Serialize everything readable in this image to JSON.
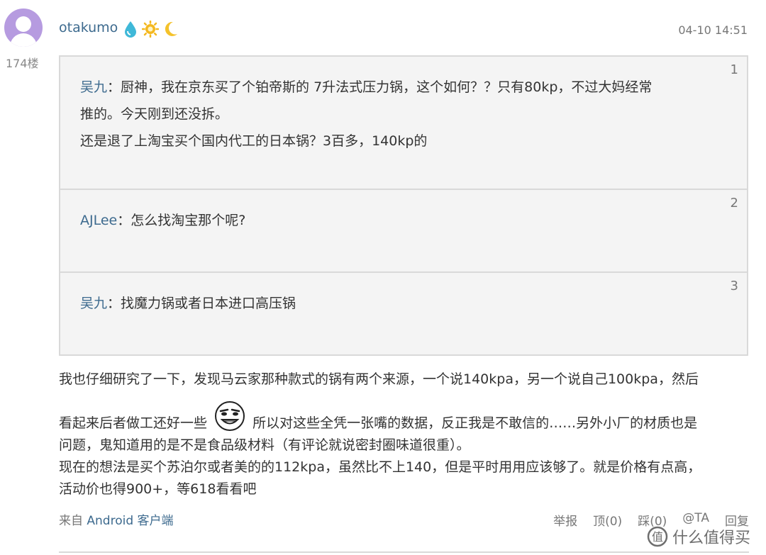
{
  "post": {
    "floor": "174楼",
    "username": "otakumo",
    "time": "04-10 14:51"
  },
  "quotes": [
    {
      "num": "1",
      "author": "吴九",
      "sep": "：",
      "lines": [
        "厨神，我在京东买了个铂帝斯的 7升法式压力锅，这个如何？？只有80kp，不过大妈经常",
        "推的。今天刚到还没拆。",
        "还是退了上淘宝买个国内代工的日本锅？3百多，140kp的"
      ]
    },
    {
      "num": "2",
      "author": "AJLee",
      "sep": "：",
      "lines": [
        "怎么找淘宝那个呢?"
      ]
    },
    {
      "num": "3",
      "author": "吴九",
      "sep": "：",
      "lines": [
        "找魔力锅或者日本进口高压锅"
      ]
    }
  ],
  "body": {
    "line1": "我也仔细研究了一下，发现马云家那种款式的锅有两个来源，一个说140kpa，另一个说自己100kpa，然后",
    "line2a": "看起来后者做工还好一些",
    "line2b": "所以对这些全凭一张嘴的数据，反正我是不敢信的……另外小厂的材质也是",
    "line3": "问题，鬼知道用的是不是食品级材料（有评论就说密封圈味道很重）。",
    "line4": "现在的想法是买个苏泊尔或者美的的112kpa，虽然比不上140，但是平时用用应该够了。就是价格有点高，",
    "line5": "活动价也得900+，等618看看吧"
  },
  "footer": {
    "from_label": "来自",
    "client": "Android 客户端",
    "report": "举报",
    "up": "顶(0)",
    "down": "踩(0)",
    "at": "@TA",
    "reply": "回复"
  },
  "watermark": {
    "text": "什么值得买",
    "badge": "值"
  },
  "colors": {
    "link": "#3d6a8e",
    "avatar": "#b69be0",
    "quote_bg": "#f4f4f4",
    "quote_border": "#d9d9d9"
  },
  "icons": [
    "user-avatar-icon",
    "water-drop-icon",
    "sun-icon",
    "moon-icon",
    "grin-emoji-icon"
  ]
}
